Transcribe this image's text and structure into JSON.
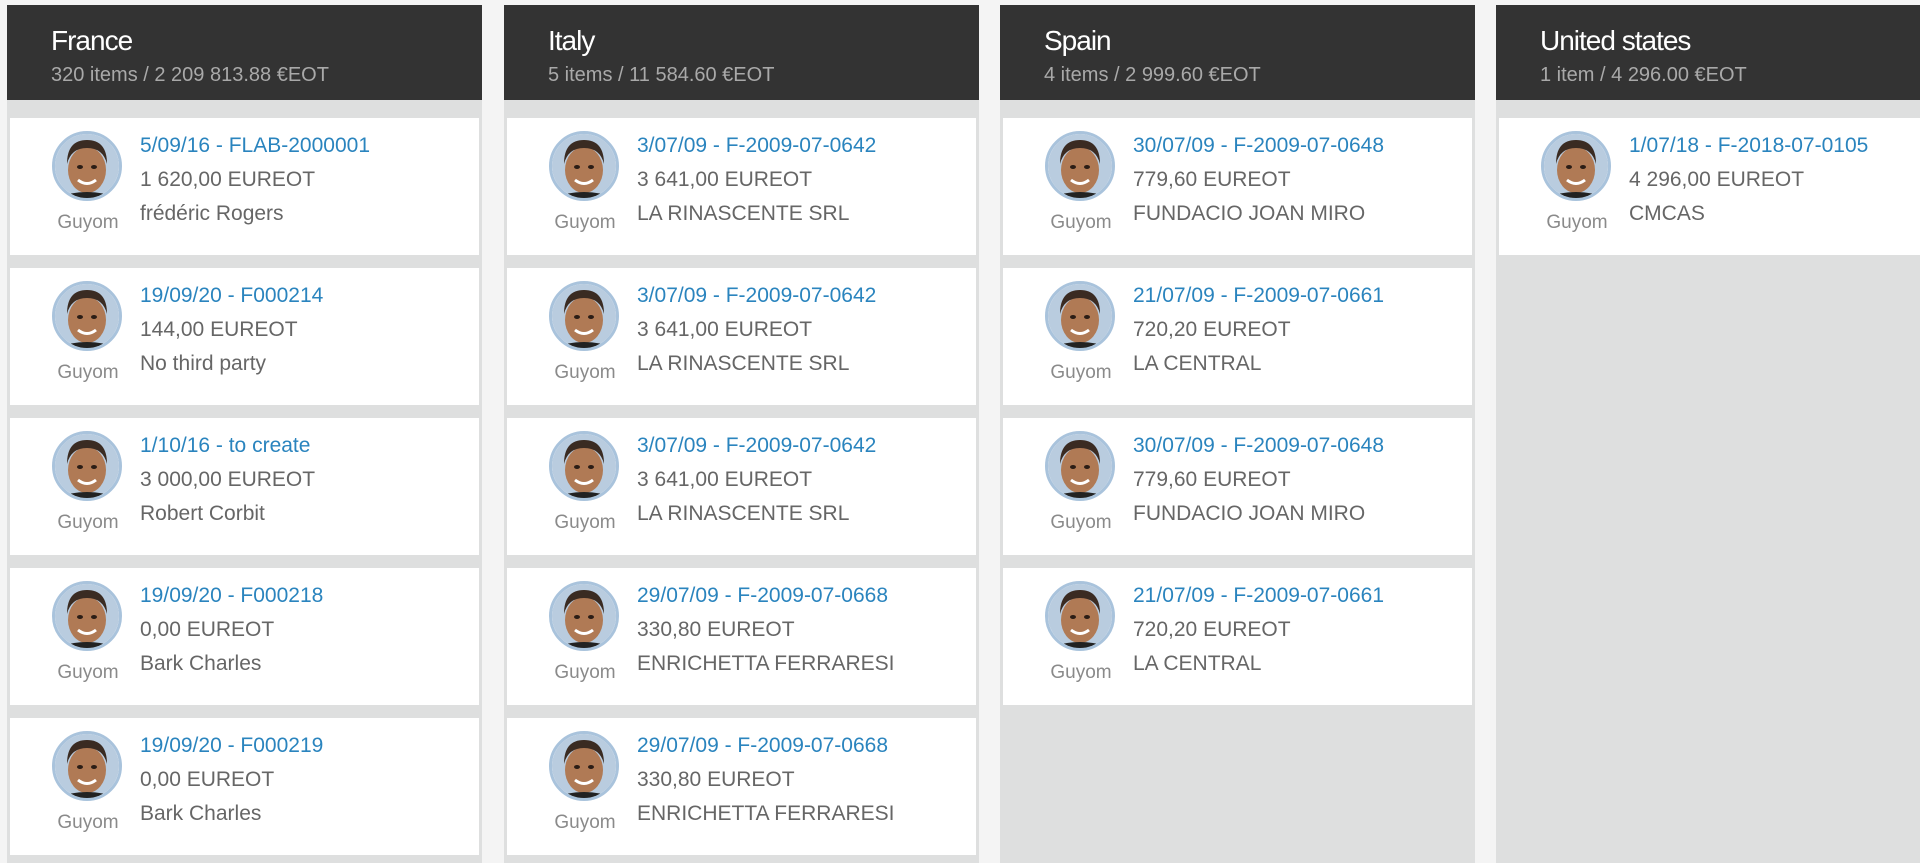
{
  "columns": [
    {
      "title": "France",
      "subtitle": "320 items / 2 209 813.88 €EOT",
      "cards": [
        {
          "ref": "5/09/16 - FLAB-2000001",
          "amount": "1 620,00 EUREOT",
          "party": "frédéric Rogers",
          "user": "Guyom"
        },
        {
          "ref": "19/09/20 - F000214",
          "amount": "144,00 EUREOT",
          "party": "No third party",
          "user": "Guyom"
        },
        {
          "ref": "1/10/16 - to create",
          "amount": "3 000,00 EUREOT",
          "party": "Robert Corbit",
          "user": "Guyom"
        },
        {
          "ref": "19/09/20 - F000218",
          "amount": "0,00 EUREOT",
          "party": "Bark Charles",
          "user": "Guyom"
        },
        {
          "ref": "19/09/20 - F000219",
          "amount": "0,00 EUREOT",
          "party": "Bark Charles",
          "user": "Guyom"
        }
      ]
    },
    {
      "title": "Italy",
      "subtitle": "5 items / 11 584.60 €EOT",
      "cards": [
        {
          "ref": "3/07/09 - F-2009-07-0642",
          "amount": "3 641,00 EUREOT",
          "party": "LA RINASCENTE SRL",
          "user": "Guyom"
        },
        {
          "ref": "3/07/09 - F-2009-07-0642",
          "amount": "3 641,00 EUREOT",
          "party": "LA RINASCENTE SRL",
          "user": "Guyom"
        },
        {
          "ref": "3/07/09 - F-2009-07-0642",
          "amount": "3 641,00 EUREOT",
          "party": "LA RINASCENTE SRL",
          "user": "Guyom"
        },
        {
          "ref": "29/07/09 - F-2009-07-0668",
          "amount": "330,80 EUREOT",
          "party": "ENRICHETTA FERRARESI",
          "user": "Guyom"
        },
        {
          "ref": "29/07/09 - F-2009-07-0668",
          "amount": "330,80 EUREOT",
          "party": "ENRICHETTA FERRARESI",
          "user": "Guyom"
        }
      ]
    },
    {
      "title": "Spain",
      "subtitle": "4 items / 2 999.60 €EOT",
      "cards": [
        {
          "ref": "30/07/09 - F-2009-07-0648",
          "amount": "779,60 EUREOT",
          "party": "FUNDACIO JOAN MIRO",
          "user": "Guyom"
        },
        {
          "ref": "21/07/09 - F-2009-07-0661",
          "amount": "720,20 EUREOT",
          "party": "LA CENTRAL",
          "user": "Guyom"
        },
        {
          "ref": "30/07/09 - F-2009-07-0648",
          "amount": "779,60 EUREOT",
          "party": "FUNDACIO JOAN MIRO",
          "user": "Guyom"
        },
        {
          "ref": "21/07/09 - F-2009-07-0661",
          "amount": "720,20 EUREOT",
          "party": "LA CENTRAL",
          "user": "Guyom"
        }
      ]
    },
    {
      "title": "United states",
      "subtitle": "1 item / 4 296.00 €EOT",
      "cards": [
        {
          "ref": "1/07/18 - F-2018-07-0105",
          "amount": "4 296,00 EUREOT",
          "party": "CMCAS",
          "user": "Guyom"
        }
      ]
    }
  ],
  "colors": {
    "header_bg": "#333333",
    "column_bg": "#dedfdf",
    "link": "#2a84be",
    "text": "#666666",
    "muted": "#a9a9a9"
  },
  "icons": {
    "avatar": "user-avatar-photo"
  }
}
